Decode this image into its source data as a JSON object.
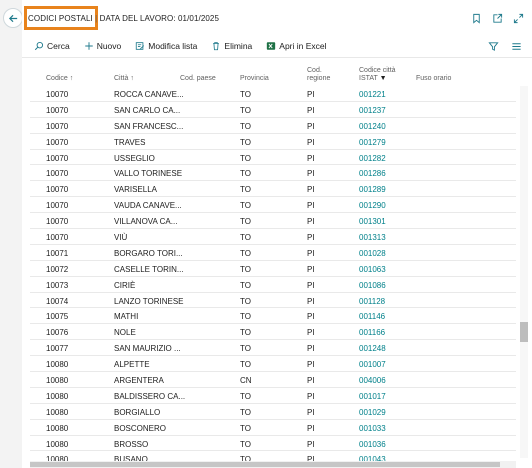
{
  "header": {
    "title": "CODICI POSTALI",
    "separator": "|",
    "work_date": "DATA DEL LAVORO: 01/01/2025"
  },
  "toolbar": {
    "search": "Cerca",
    "new": "Nuovo",
    "edit_list": "Modifica lista",
    "delete": "Elimina",
    "open_excel": "Apri in Excel"
  },
  "columns": {
    "codice": "Codice",
    "citta": "Città",
    "paese": "Cod. paese",
    "provincia": "Provincia",
    "regione_1": "Cod.",
    "regione_2": "regione",
    "istat_1": "Codice città",
    "istat_2": "ISTAT",
    "istat_filter": "▼",
    "fuso": "Fuso orario"
  },
  "rows": [
    {
      "codice": "10070",
      "citta": "ROCCA CANAVE...",
      "paese": "",
      "provincia": "TO",
      "regione": "PI",
      "istat": "001221",
      "fuso": ""
    },
    {
      "codice": "10070",
      "citta": "SAN CARLO CA...",
      "paese": "",
      "provincia": "TO",
      "regione": "PI",
      "istat": "001237",
      "fuso": ""
    },
    {
      "codice": "10070",
      "citta": "SAN FRANCESC...",
      "paese": "",
      "provincia": "TO",
      "regione": "PI",
      "istat": "001240",
      "fuso": ""
    },
    {
      "codice": "10070",
      "citta": "TRAVES",
      "paese": "",
      "provincia": "TO",
      "regione": "PI",
      "istat": "001279",
      "fuso": ""
    },
    {
      "codice": "10070",
      "citta": "USSEGLIO",
      "paese": "",
      "provincia": "TO",
      "regione": "PI",
      "istat": "001282",
      "fuso": ""
    },
    {
      "codice": "10070",
      "citta": "VALLO TORINESE",
      "paese": "",
      "provincia": "TO",
      "regione": "PI",
      "istat": "001286",
      "fuso": ""
    },
    {
      "codice": "10070",
      "citta": "VARISELLA",
      "paese": "",
      "provincia": "TO",
      "regione": "PI",
      "istat": "001289",
      "fuso": ""
    },
    {
      "codice": "10070",
      "citta": "VAUDA CANAVE...",
      "paese": "",
      "provincia": "TO",
      "regione": "PI",
      "istat": "001290",
      "fuso": ""
    },
    {
      "codice": "10070",
      "citta": "VILLANOVA CA...",
      "paese": "",
      "provincia": "TO",
      "regione": "PI",
      "istat": "001301",
      "fuso": ""
    },
    {
      "codice": "10070",
      "citta": "VIÙ",
      "paese": "",
      "provincia": "TO",
      "regione": "PI",
      "istat": "001313",
      "fuso": ""
    },
    {
      "codice": "10071",
      "citta": "BORGARO TORI...",
      "paese": "",
      "provincia": "TO",
      "regione": "PI",
      "istat": "001028",
      "fuso": ""
    },
    {
      "codice": "10072",
      "citta": "CASELLE TORIN...",
      "paese": "",
      "provincia": "TO",
      "regione": "PI",
      "istat": "001063",
      "fuso": ""
    },
    {
      "codice": "10073",
      "citta": "CIRIÈ",
      "paese": "",
      "provincia": "TO",
      "regione": "PI",
      "istat": "001086",
      "fuso": ""
    },
    {
      "codice": "10074",
      "citta": "LANZO TORINESE",
      "paese": "",
      "provincia": "TO",
      "regione": "PI",
      "istat": "001128",
      "fuso": ""
    },
    {
      "codice": "10075",
      "citta": "MATHI",
      "paese": "",
      "provincia": "TO",
      "regione": "PI",
      "istat": "001146",
      "fuso": ""
    },
    {
      "codice": "10076",
      "citta": "NOLE",
      "paese": "",
      "provincia": "TO",
      "regione": "PI",
      "istat": "001166",
      "fuso": ""
    },
    {
      "codice": "10077",
      "citta": "SAN MAURIZIO ...",
      "paese": "",
      "provincia": "TO",
      "regione": "PI",
      "istat": "001248",
      "fuso": ""
    },
    {
      "codice": "10080",
      "citta": "ALPETTE",
      "paese": "",
      "provincia": "TO",
      "regione": "PI",
      "istat": "001007",
      "fuso": ""
    },
    {
      "codice": "10080",
      "citta": "ARGENTERA",
      "paese": "",
      "provincia": "CN",
      "regione": "PI",
      "istat": "004006",
      "fuso": ""
    },
    {
      "codice": "10080",
      "citta": "BALDISSERO CA...",
      "paese": "",
      "provincia": "TO",
      "regione": "PI",
      "istat": "001017",
      "fuso": ""
    },
    {
      "codice": "10080",
      "citta": "BORGIALLO",
      "paese": "",
      "provincia": "TO",
      "regione": "PI",
      "istat": "001029",
      "fuso": ""
    },
    {
      "codice": "10080",
      "citta": "BOSCONERO",
      "paese": "",
      "provincia": "TO",
      "regione": "PI",
      "istat": "001033",
      "fuso": ""
    },
    {
      "codice": "10080",
      "citta": "BROSSO",
      "paese": "",
      "provincia": "TO",
      "regione": "PI",
      "istat": "001036",
      "fuso": ""
    },
    {
      "codice": "10080",
      "citta": "BUSANO",
      "paese": "",
      "provincia": "TO",
      "regione": "PI",
      "istat": "001043",
      "fuso": ""
    }
  ],
  "colors": {
    "highlight": "#e8831c",
    "link": "#00808a",
    "accent": "#1f7a8c"
  },
  "icons": [
    "back-arrow-icon",
    "bookmark-icon",
    "open-new-window-icon",
    "expand-icon",
    "search-icon",
    "plus-icon",
    "edit-list-icon",
    "trash-icon",
    "excel-icon",
    "filter-icon",
    "list-icon"
  ]
}
